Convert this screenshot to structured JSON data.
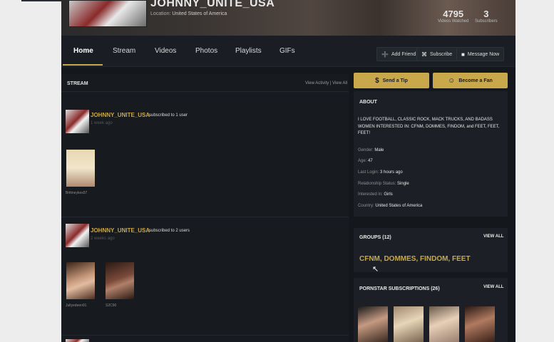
{
  "profile": {
    "username": "JOHNNY_UNITE_USA",
    "location_label": "Location:",
    "location_value": "United States of America",
    "stats": [
      {
        "num": "4795",
        "label": "Videos Watched"
      },
      {
        "num": "3",
        "label": "Subscribers"
      }
    ]
  },
  "nav": {
    "tabs": [
      "Home",
      "Stream",
      "Videos",
      "Photos",
      "Playlists",
      "GIFs"
    ],
    "active": "Home",
    "add_friend": "Add Friend",
    "subscribe": "Subscribe",
    "message": "Message Now"
  },
  "stream": {
    "heading": "STREAM",
    "links": "View Activity | View All",
    "entries": [
      {
        "name": "JOHNNY_UNITE_USA",
        "action": "subscribed to 1 user",
        "time": "1 week ago",
        "captions": [
          "Brittneykes97"
        ]
      },
      {
        "name": "JOHNNY_UNITE_USA",
        "action": "subscribed to 2 users",
        "time": "2 weeks ago",
        "captions": [
          "Jullyedeen91",
          "S2C90"
        ]
      }
    ]
  },
  "sidebar": {
    "tip": "Send a Tip",
    "fan": "Become a Fan",
    "about_title": "ABOUT",
    "about_text": "I LOVE FOOTBALL, CLASSIC ROCK, MACK TRUCKS, AND BADASS WOMEN INTERESTED IN: CFNM, DOMMES, FINDOM, and FEET, FEET, FEET!",
    "details": [
      {
        "k": "Gender:",
        "v": "Male"
      },
      {
        "k": "Age:",
        "v": "47"
      },
      {
        "k": "Last Login:",
        "v": "3 hours ago"
      },
      {
        "k": "Relationship Status:",
        "v": "Single"
      },
      {
        "k": "Interested in:",
        "v": "Girls"
      },
      {
        "k": "Country:",
        "v": "United States of America"
      }
    ],
    "groups_title": "GROUPS (12)",
    "groups_viewall": "VIEW ALL",
    "groups_text": "CFNM, DOMMES, FINDOM, FEET",
    "subs_title": "PORNSTAR SUBSCRIPTIONS (26)",
    "subs_viewall": "VIEW ALL"
  }
}
